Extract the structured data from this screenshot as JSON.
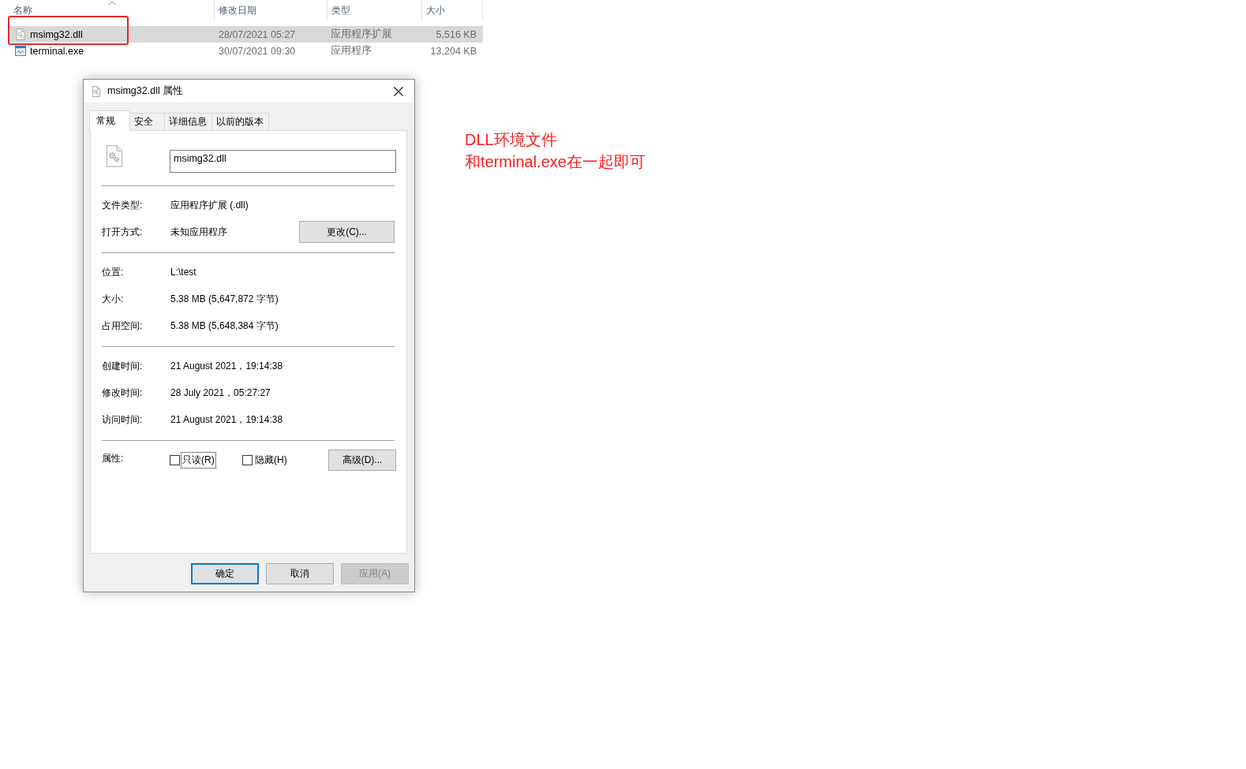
{
  "file_list": {
    "columns": [
      {
        "label": "名称",
        "sorted": true
      },
      {
        "label": "修改日期",
        "sorted": false
      },
      {
        "label": "类型",
        "sorted": false
      },
      {
        "label": "大小",
        "sorted": false
      }
    ],
    "rows": [
      {
        "kind": "library",
        "name": "msimg32.dll",
        "modified": "28/07/2021 05:27",
        "type": "应用程序扩展",
        "size": "5,516 KB",
        "selected": true,
        "highlighted": true
      },
      {
        "kind": "application",
        "name": "terminal.exe",
        "modified": "30/07/2021 09:30",
        "type": "应用程序",
        "size": "13,204 KB",
        "selected": false,
        "highlighted": false
      }
    ]
  },
  "dialog": {
    "title": "msimg32.dll 属性",
    "tabs": [
      {
        "label": "常规",
        "selected": true
      },
      {
        "label": "安全",
        "selected": false
      },
      {
        "label": "详细信息",
        "selected": false
      },
      {
        "label": "以前的版本",
        "selected": false
      }
    ],
    "file_name": "msimg32.dll",
    "sections": [
      {
        "rows": [
          {
            "label": "文件类型:",
            "value": "应用程序扩展 (.dll)"
          },
          {
            "label": "打开方式:",
            "value": "未知应用程序",
            "button": "更改(C)..."
          }
        ]
      },
      {
        "rows": [
          {
            "label": "位置:",
            "value": "L:\\test"
          },
          {
            "label": "大小:",
            "value": "5.38 MB (5,647,872 字节)"
          },
          {
            "label": "占用空间:",
            "value": "5.38 MB (5,648,384 字节)"
          }
        ]
      },
      {
        "rows": [
          {
            "label": "创建时间:",
            "value": "21 August 2021，19:14:38"
          },
          {
            "label": "修改时间:",
            "value": "28 July 2021，05:27:27"
          },
          {
            "label": "访问时间:",
            "value": "21 August 2021，19:14:38"
          }
        ]
      }
    ],
    "attributes": {
      "label": "属性:",
      "checkboxes": [
        {
          "label": "只读(R)",
          "checked": false,
          "focused": true
        },
        {
          "label": "隐藏(H)",
          "checked": false,
          "focused": false
        }
      ],
      "button": "高级(D)..."
    },
    "buttons": [
      {
        "label": "确定",
        "default": true,
        "disabled": false
      },
      {
        "label": "取消",
        "default": false,
        "disabled": false
      },
      {
        "label": "应用(A)",
        "default": false,
        "disabled": true
      }
    ]
  },
  "note": {
    "lines": [
      "DLL环境文件",
      "和terminal.exe在一起即可"
    ]
  }
}
